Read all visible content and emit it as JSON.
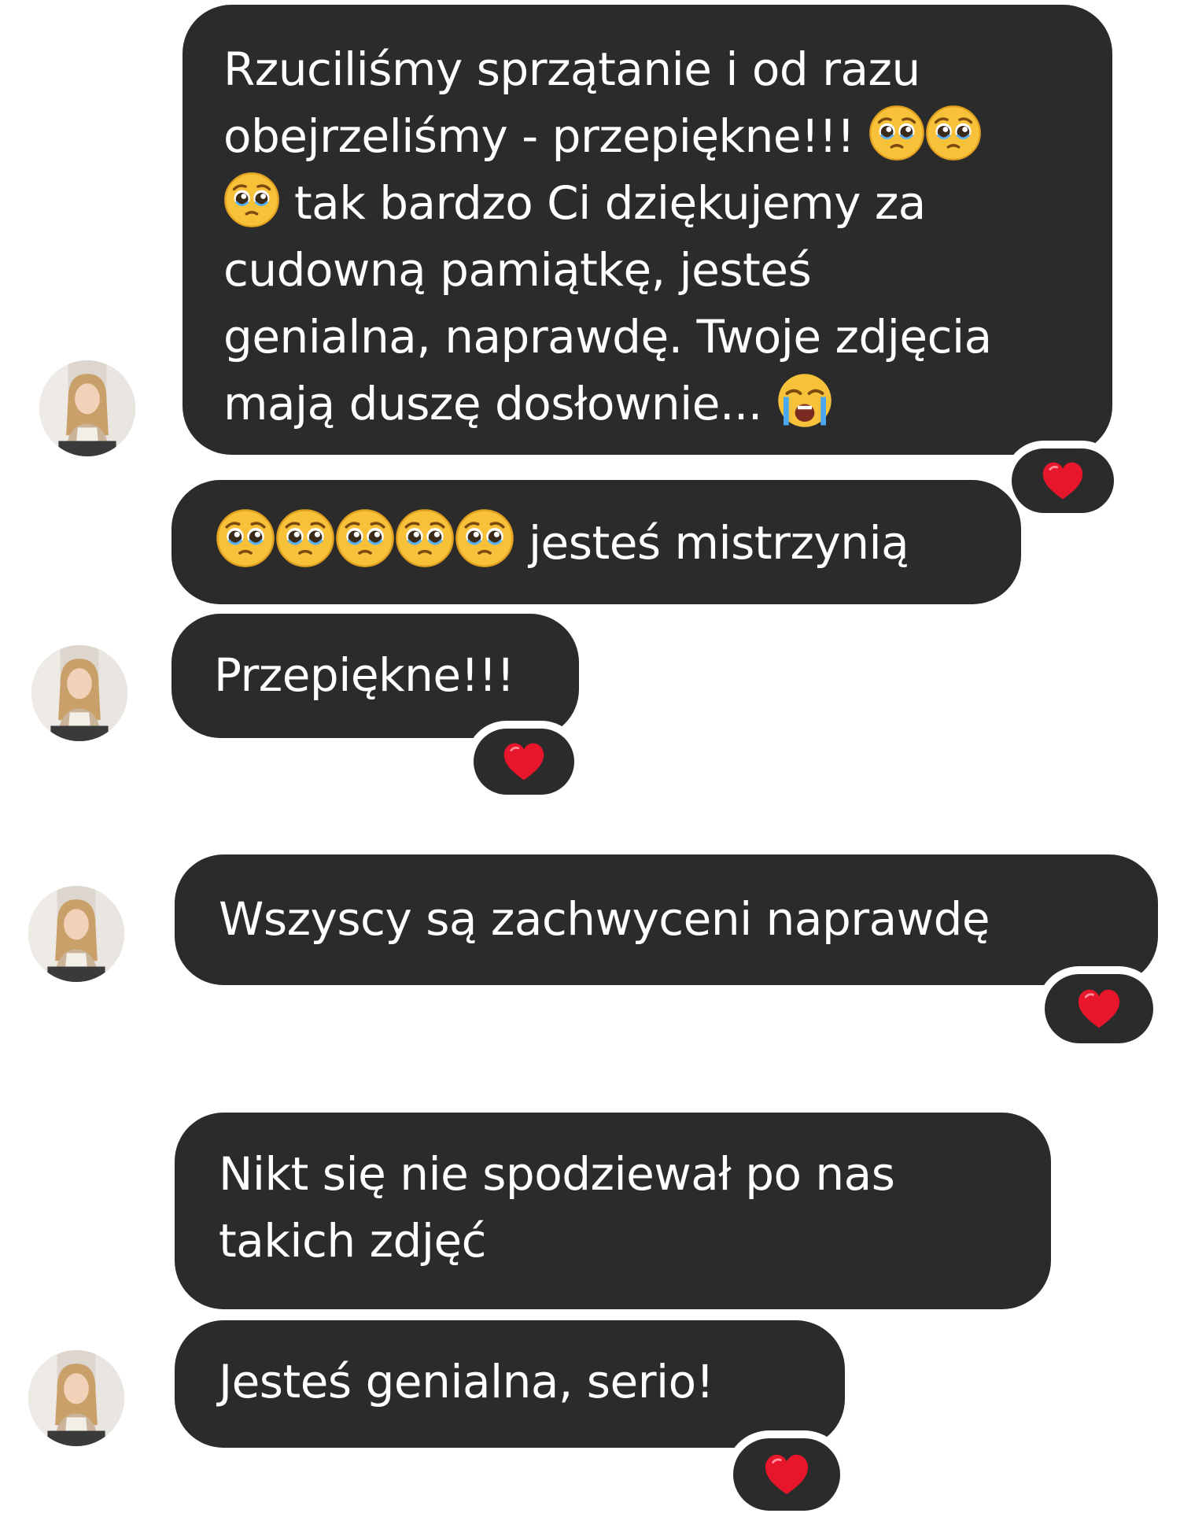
{
  "conversation": {
    "messages": [
      {
        "id": "m1",
        "lines": [
          "Rzuciliśmy sprzątanie i od razu",
          "obejrzeliśmy - przepiękne!!!",
          "tak bardzo Ci dziękujemy za",
          "cudowną pamiątkę, jesteś",
          "genialna, naprawdę. Twoje zdjęcia",
          "mają duszę dosłownie..."
        ],
        "emoji": [
          "pleading-face",
          "pleading-face",
          "pleading-face",
          "crying-face"
        ],
        "reaction": "❤️"
      },
      {
        "id": "m2",
        "text": "jesteś mistrzynią",
        "emoji": [
          "pleading-face",
          "pleading-face",
          "pleading-face",
          "pleading-face",
          "pleading-face"
        ]
      },
      {
        "id": "m3",
        "text": "Przepiękne!!!",
        "reaction": "❤️"
      },
      {
        "id": "m4",
        "text": "Wszyscy są zachwyceni naprawdę",
        "reaction": "❤️"
      },
      {
        "id": "m5",
        "lines": [
          "Nikt się nie spodziewał po nas",
          "takich zdjęć"
        ]
      },
      {
        "id": "m6",
        "text": "Jesteś genialna, serio!",
        "reaction": "❤️"
      }
    ]
  },
  "colors": {
    "bubble": "#2b2b2b",
    "text": "#ffffff",
    "background": "#ffffff",
    "heart": "#e8162b"
  },
  "icons": {
    "avatar": "avatar-photo",
    "reaction": "heart-icon"
  }
}
